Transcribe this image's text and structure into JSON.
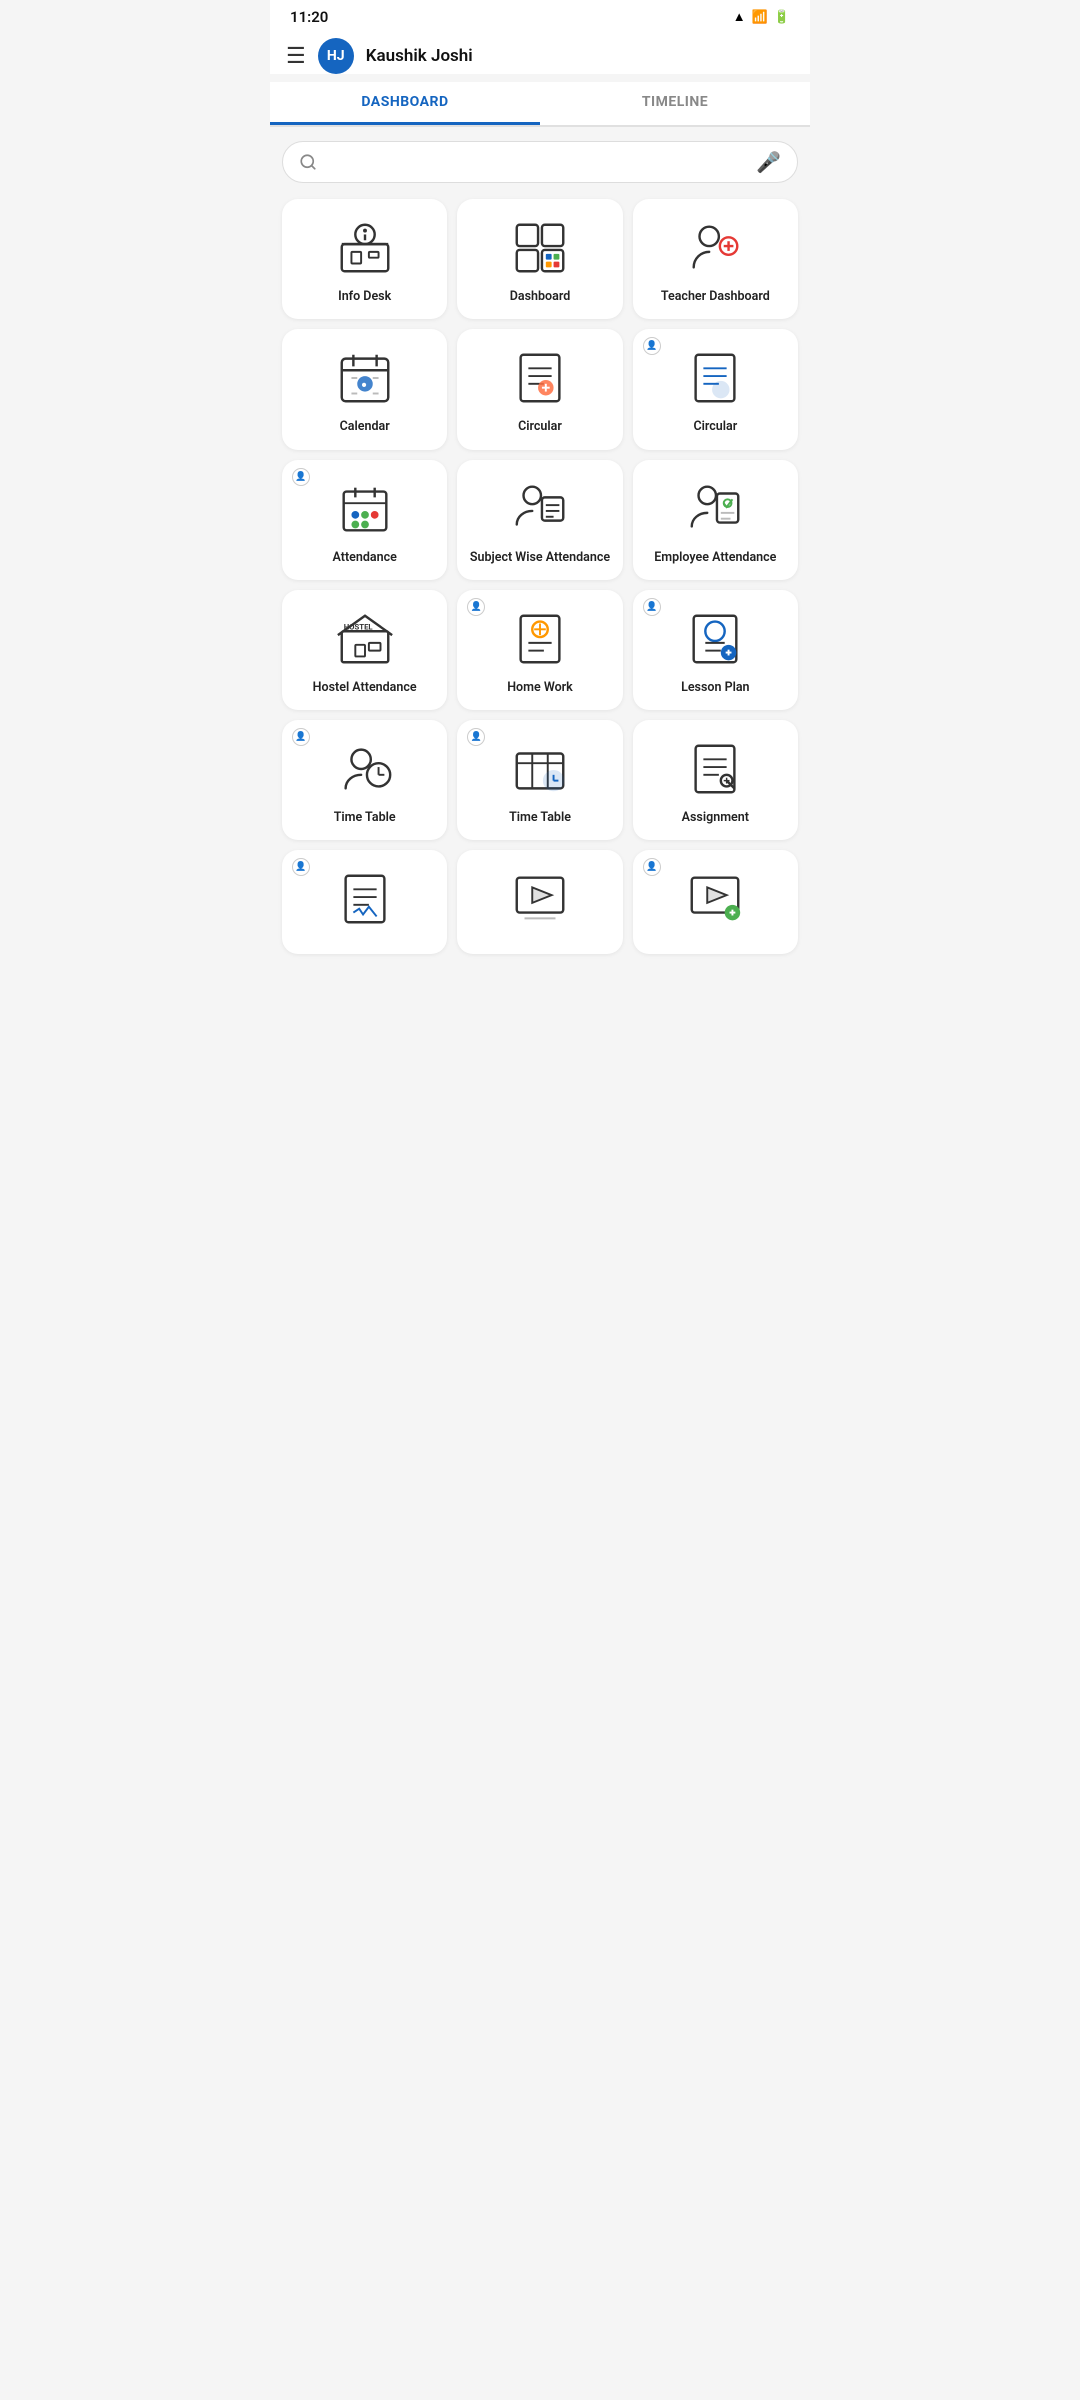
{
  "statusBar": {
    "time": "11:20",
    "icons": [
      "wifi",
      "battery"
    ]
  },
  "nav": {
    "user_initials": "HJ",
    "user_name": "Kaushik  Joshi"
  },
  "tabs": [
    {
      "id": "dashboard",
      "label": "DASHBOARD",
      "active": true
    },
    {
      "id": "timeline",
      "label": "TIMELINE",
      "active": false
    }
  ],
  "search": {
    "placeholder": ""
  },
  "cards": [
    {
      "id": "info-desk",
      "label": "Info Desk",
      "badge": false
    },
    {
      "id": "dashboard",
      "label": "Dashboard",
      "badge": false
    },
    {
      "id": "teacher-dashboard",
      "label": "Teacher Dashboard",
      "badge": false
    },
    {
      "id": "calendar",
      "label": "Calendar",
      "badge": false
    },
    {
      "id": "circular-1",
      "label": "Circular",
      "badge": false
    },
    {
      "id": "circular-2",
      "label": "Circular",
      "badge": true
    },
    {
      "id": "attendance",
      "label": "Attendance",
      "badge": true
    },
    {
      "id": "subject-wise-attendance",
      "label": "Subject Wise Attendance",
      "badge": false
    },
    {
      "id": "employee-attendance",
      "label": "Employee Attendance",
      "badge": false
    },
    {
      "id": "hostel-attendance",
      "label": "Hostel Attendance",
      "badge": false
    },
    {
      "id": "home-work",
      "label": "Home Work",
      "badge": true
    },
    {
      "id": "lesson-plan",
      "label": "Lesson Plan",
      "badge": true
    },
    {
      "id": "time-table-1",
      "label": "Time Table",
      "badge": true
    },
    {
      "id": "time-table-2",
      "label": "Time Table",
      "badge": true
    },
    {
      "id": "assignment",
      "label": "Assignment",
      "badge": false
    },
    {
      "id": "item-16",
      "label": "",
      "badge": true
    },
    {
      "id": "item-17",
      "label": "",
      "badge": false
    },
    {
      "id": "item-18",
      "label": "",
      "badge": true
    }
  ]
}
